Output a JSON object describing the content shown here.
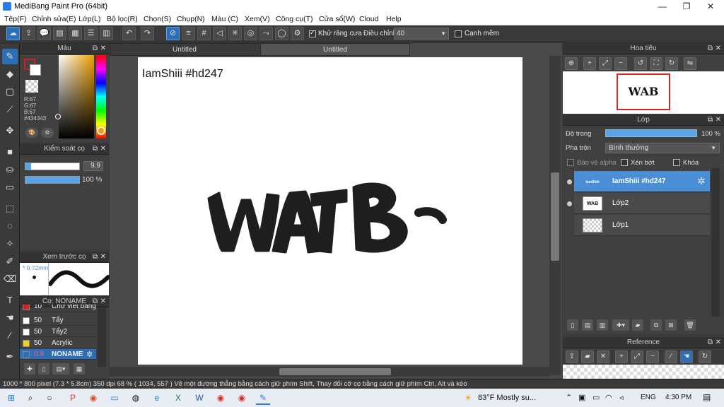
{
  "window": {
    "title": "MediBang Paint Pro (64bit)"
  },
  "menu": [
    "Tệp(F)",
    "Chỉnh sửa(E)",
    "Lớp(L)",
    "Bộ lọc(R)",
    "Chọn(S)",
    "Chụp(N)",
    "Màu (C)",
    "Xem(V)",
    "Công cụ(T)",
    "Cửa sổ(W)",
    "Cloud",
    "Help"
  ],
  "toolbar": {
    "antialias_label": "Khử răng cưa",
    "antialias_checked": true,
    "adjust_label": "Điều chỉnh",
    "adjust_value": "40",
    "smooth_label": "Cạnh mềm",
    "smooth_checked": false
  },
  "panels": {
    "color": {
      "title": "Màu",
      "fg_color": "#434343",
      "bg_color": "#ffffff",
      "r": "R:67",
      "g": "G:67",
      "b": "B:67",
      "hex": "#434343"
    },
    "brush_control": {
      "title": "Kiểm soát cọ",
      "size_value": "9.9",
      "opacity_value": "100 %",
      "size_fraction": 0.1,
      "opacity_fraction": 1.0
    },
    "brush_preview": {
      "title": "Xem trước cọ",
      "size_label": "* 0.72mm"
    },
    "brush_list": {
      "title": "Cọ: NONAME",
      "items": [
        {
          "size": "10",
          "name": "Chữ viết bằng",
          "color": "#e02020"
        },
        {
          "size": "50",
          "name": "Tẩy",
          "color": "#ffffff"
        },
        {
          "size": "50",
          "name": "Tẩy2",
          "color": "#ffffff"
        },
        {
          "size": "50",
          "name": "Acrylic",
          "color": "#e8d020"
        },
        {
          "size": "0.9",
          "name": "NONAME",
          "color": "#2d6fb6"
        }
      ]
    },
    "navigator": {
      "title": "Hoa tiêu",
      "thumb_text": "WAB"
    },
    "layers": {
      "title": "Lớp",
      "opacity_label": "Độ trong",
      "opacity_value": "100 %",
      "blend_label": "Pha trộn",
      "blend_value": "Bình thường",
      "protect_alpha": "Bảo vệ alpha",
      "clipping": "Xén bớt",
      "lock": "Khóa",
      "items": [
        {
          "name": "IamShiii #hd247",
          "thumb": "IamShiii",
          "visible": true,
          "selected": true
        },
        {
          "name": "Lớp2",
          "thumb": "WAB",
          "visible": true,
          "selected": false
        },
        {
          "name": "Lớp1",
          "thumb": "",
          "visible": false,
          "selected": false
        }
      ]
    },
    "reference": {
      "title": "Reference"
    }
  },
  "document": {
    "tabs": [
      "Untitled",
      "Untitled"
    ],
    "text": "IamShiii #hd247",
    "art_text": "WAB"
  },
  "status": "1000 * 800 pixel   (7.3 * 5.8cm)   350 dpi   68 %   ( 1034, 557 )   Vẽ một đường thẳng bằng cách giữ phím Shift, Thay đổi cỡ cọ bằng cách giữ phím Ctrl, Alt và kéo",
  "taskbar": {
    "weather": "83°F  Mostly su...",
    "lang": "ENG",
    "time": "4:30 PM"
  }
}
